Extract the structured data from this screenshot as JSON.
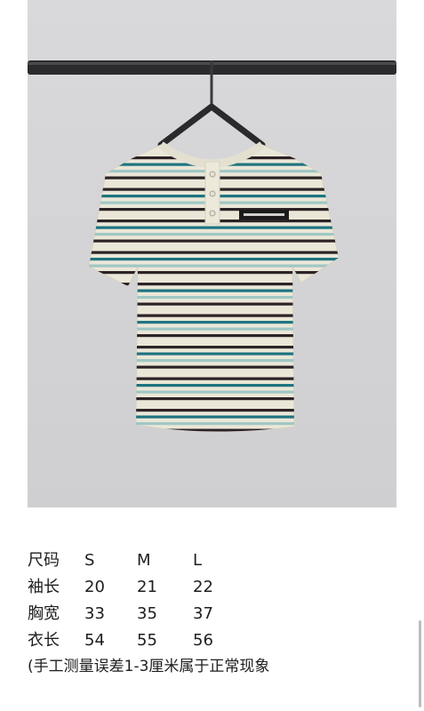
{
  "product_photo": {
    "alt": "striped knit short-sleeve top on hanger",
    "colors": {
      "background": "#d5d5d7",
      "rail": "#2b2b2e",
      "knit": "#ebe7d8",
      "stripe_dark": "#2c2226",
      "stripe_teal": "#1f7480",
      "stripe_pale_teal": "#9fc7c4",
      "label": "#1a1a1a"
    }
  },
  "size_table": {
    "header": [
      "尺码",
      "S",
      "M",
      "L"
    ],
    "rows": [
      {
        "label": "袖长",
        "values": [
          "20",
          "21",
          "22"
        ]
      },
      {
        "label": "胸宽",
        "values": [
          "33",
          "35",
          "37"
        ]
      },
      {
        "label": "衣长",
        "values": [
          "54",
          "55",
          "56"
        ]
      }
    ]
  },
  "note": "(手工测量误差1-3厘米属于正常现象"
}
